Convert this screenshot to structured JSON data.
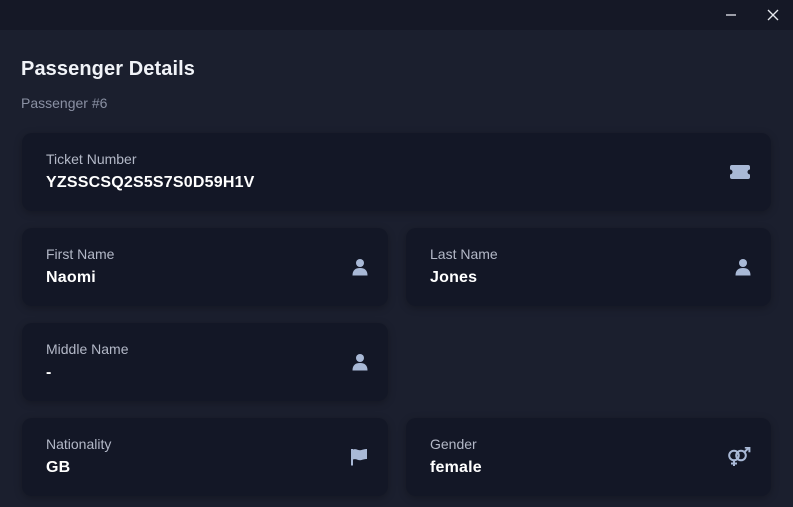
{
  "window": {
    "minimize_icon": "minimize-icon",
    "close_icon": "close-icon"
  },
  "header": {
    "title": "Passenger Details",
    "subtitle": "Passenger #6"
  },
  "fields": {
    "ticket": {
      "label": "Ticket Number",
      "value": "YZSSCSQ2S5S7S0D59H1V",
      "icon": "ticket-icon"
    },
    "first_name": {
      "label": "First Name",
      "value": "Naomi",
      "icon": "user-icon"
    },
    "last_name": {
      "label": "Last Name",
      "value": "Jones",
      "icon": "user-icon"
    },
    "middle_name": {
      "label": "Middle Name",
      "value": "-",
      "icon": "user-icon"
    },
    "nationality": {
      "label": "Nationality",
      "value": "GB",
      "icon": "flag-icon"
    },
    "gender": {
      "label": "Gender",
      "value": "female",
      "icon": "gender-icon"
    }
  },
  "colors": {
    "background": "#1b1f2e",
    "card": "#131726",
    "icon": "#a9b9d6"
  }
}
